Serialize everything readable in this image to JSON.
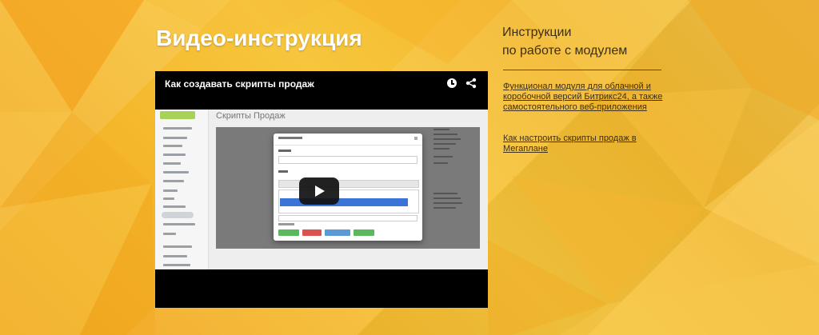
{
  "section": {
    "title": "Видео-инструкция"
  },
  "video": {
    "title": "Как создавать скрипты продаж",
    "screen_title": "Скрипты Продаж",
    "icons": [
      "clock-icon",
      "share-icon",
      "play-icon"
    ]
  },
  "sidebar": {
    "title": "Инструкции\nпо работе с модулем",
    "links": [
      {
        "label": "Функционал модуля для облачной и коробочной версий Битрикс24, а также самостоятельного веб-приложения"
      },
      {
        "label": "Как настроить скрипты продаж в Мегаплане"
      }
    ]
  },
  "colors": {
    "background": "#f4b52a",
    "title_text": "#ffffff",
    "link_text": "#3b2f16"
  }
}
